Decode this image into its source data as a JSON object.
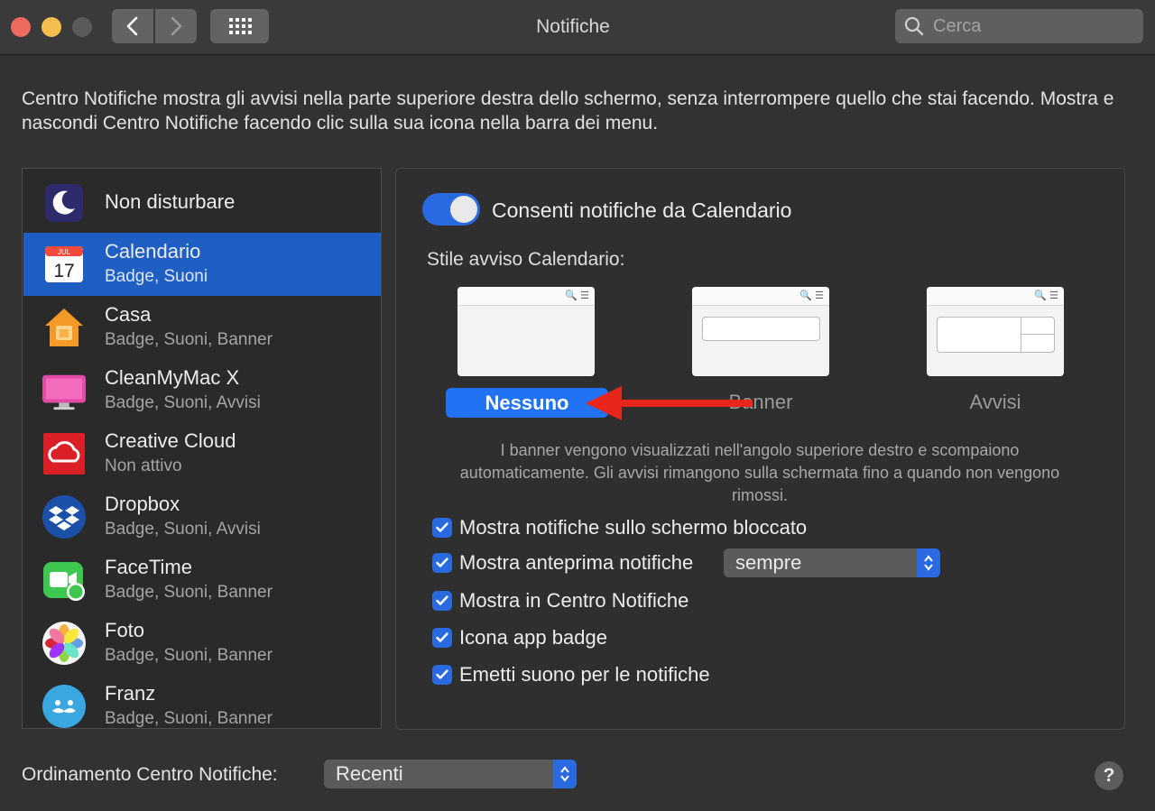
{
  "window": {
    "title": "Notifiche",
    "search_placeholder": "Cerca"
  },
  "description": "Centro Notifiche mostra gli avvisi nella parte superiore destra dello schermo, senza interrompere quello che stai facendo. Mostra e nascondi Centro Notifiche facendo clic sulla sua icona nella barra dei menu.",
  "sidebar": {
    "items": [
      {
        "name": "Non disturbare",
        "sub": "",
        "icon": "moon-icon"
      },
      {
        "name": "Calendario",
        "sub": "Badge, Suoni",
        "icon": "calendar-icon",
        "selected": true
      },
      {
        "name": "Casa",
        "sub": "Badge, Suoni, Banner",
        "icon": "home-icon"
      },
      {
        "name": "CleanMyMac X",
        "sub": "Badge, Suoni, Avvisi",
        "icon": "cleanmymac-icon"
      },
      {
        "name": "Creative Cloud",
        "sub": "Non attivo",
        "icon": "creative-cloud-icon"
      },
      {
        "name": "Dropbox",
        "sub": "Badge, Suoni, Avvisi",
        "icon": "dropbox-icon"
      },
      {
        "name": "FaceTime",
        "sub": "Badge, Suoni, Banner",
        "icon": "facetime-icon"
      },
      {
        "name": "Foto",
        "sub": "Badge, Suoni, Banner",
        "icon": "photos-icon"
      },
      {
        "name": "Franz",
        "sub": "Badge, Suoni, Banner",
        "icon": "franz-icon"
      }
    ],
    "calendar_month": "JUL",
    "calendar_day": "17"
  },
  "panel": {
    "allow_label": "Consenti notifiche da Calendario",
    "allow_enabled": true,
    "style_label": "Stile avviso Calendario:",
    "styles": [
      "Nessuno",
      "Banner",
      "Avvisi"
    ],
    "selected_style": "Nessuno",
    "hint": "I banner vengono visualizzati nell'angolo superiore destro e scompaiono automaticamente. Gli avvisi rimangono sulla schermata fino a quando non vengono rimossi.",
    "checkboxes": [
      {
        "label": "Mostra notifiche sullo schermo bloccato",
        "checked": true
      },
      {
        "label": "Mostra anteprima notifiche",
        "checked": true
      },
      {
        "label": "Mostra in Centro Notifiche",
        "checked": true
      },
      {
        "label": "Icona app badge",
        "checked": true
      },
      {
        "label": "Emetti suono per le notifiche",
        "checked": true
      }
    ],
    "preview_select": "sempre"
  },
  "footer": {
    "sort_label": "Ordinamento Centro Notifiche:",
    "sort_value": "Recenti",
    "help": "?"
  },
  "colors": {
    "accent": "#2173f3",
    "selection": "#1f5fc4",
    "arrow": "#e8261c"
  }
}
